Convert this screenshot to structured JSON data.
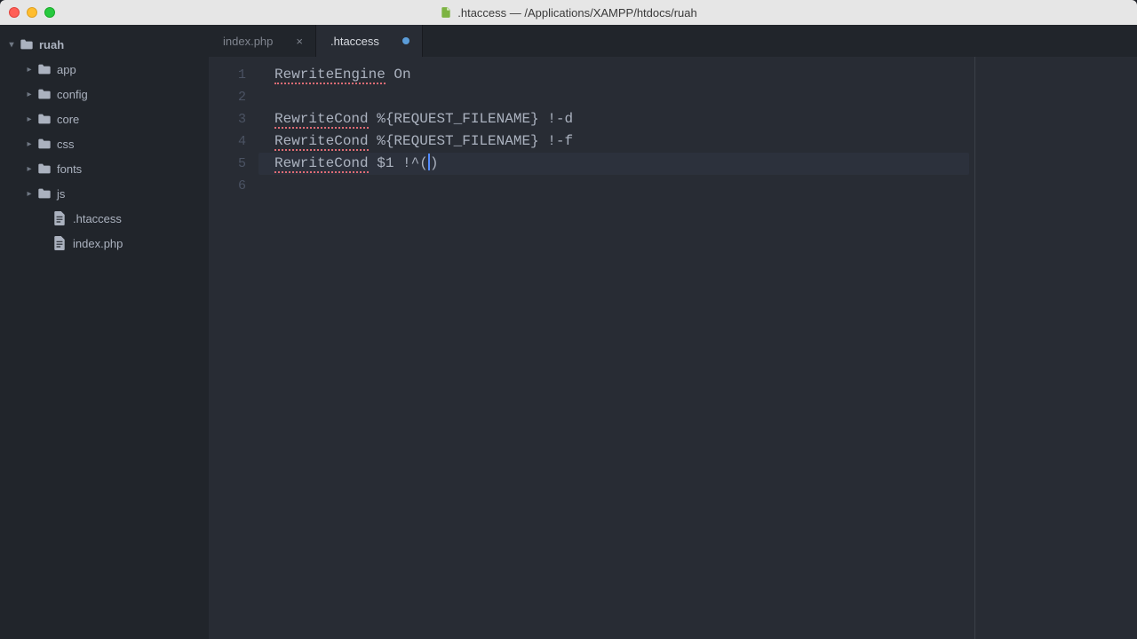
{
  "titlebar": {
    "title": ".htaccess — /Applications/XAMPP/htdocs/ruah"
  },
  "sidebar": {
    "root": "ruah",
    "items": [
      {
        "name": "app",
        "type": "folder"
      },
      {
        "name": "config",
        "type": "folder"
      },
      {
        "name": "core",
        "type": "folder"
      },
      {
        "name": "css",
        "type": "folder"
      },
      {
        "name": "fonts",
        "type": "folder"
      },
      {
        "name": "js",
        "type": "folder"
      },
      {
        "name": ".htaccess",
        "type": "file"
      },
      {
        "name": "index.php",
        "type": "file"
      }
    ]
  },
  "tabs": [
    {
      "label": "index.php",
      "active": false,
      "dirty": false
    },
    {
      "label": ".htaccess",
      "active": true,
      "dirty": true
    }
  ],
  "code": {
    "lines": [
      "RewriteEngine On",
      "",
      "RewriteCond %{REQUEST_FILENAME} !-d",
      "RewriteCond %{REQUEST_FILENAME} !-f",
      "RewriteCond $1 !^()",
      ""
    ],
    "line_numbers": [
      "1",
      "2",
      "3",
      "4",
      "5",
      "6"
    ],
    "active_line_index": 4
  }
}
